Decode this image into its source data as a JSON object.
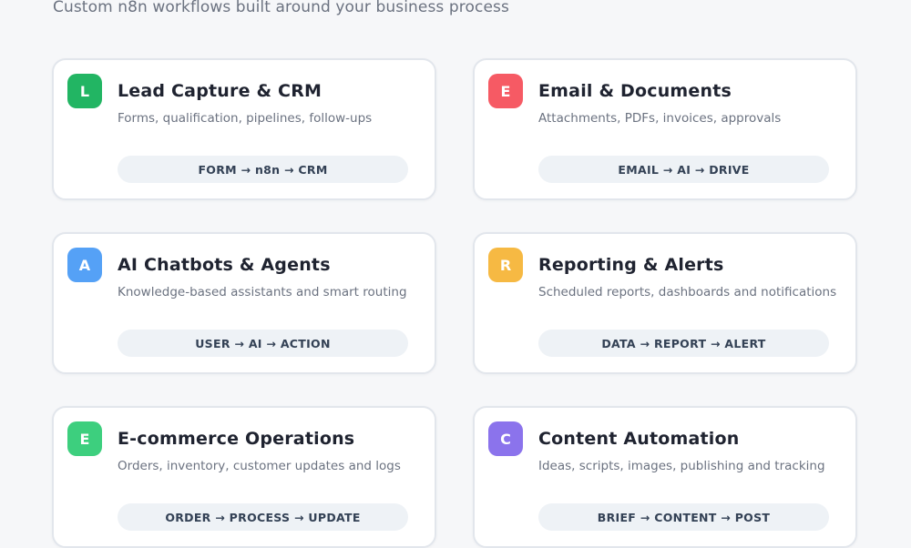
{
  "header": {
    "subtitle": "Custom n8n workflows built around your business process"
  },
  "cards": [
    {
      "letter": "L",
      "color": "#22b563",
      "title": "Lead Capture & CRM",
      "description": "Forms, qualification, pipelines, follow-ups",
      "flow": "FORM → n8n → CRM"
    },
    {
      "letter": "E",
      "color": "#f65a64",
      "title": "Email & Documents",
      "description": "Attachments, PDFs, invoices, approvals",
      "flow": "EMAIL → AI → DRIVE"
    },
    {
      "letter": "A",
      "color": "#55a1f6",
      "title": "AI Chatbots & Agents",
      "description": "Knowledge-based assistants and smart routing",
      "flow": "USER → AI → ACTION"
    },
    {
      "letter": "R",
      "color": "#f6b943",
      "title": "Reporting & Alerts",
      "description": "Scheduled reports, dashboards and notifications",
      "flow": "DATA → REPORT → ALERT"
    },
    {
      "letter": "E",
      "color": "#3dcf7e",
      "title": "E-commerce Operations",
      "description": "Orders, inventory, customer updates and logs",
      "flow": "ORDER → PROCESS → UPDATE"
    },
    {
      "letter": "C",
      "color": "#8b73ec",
      "title": "Content Automation",
      "description": "Ideas, scripts, images, publishing and tracking",
      "flow": "BRIEF → CONTENT → POST"
    }
  ]
}
